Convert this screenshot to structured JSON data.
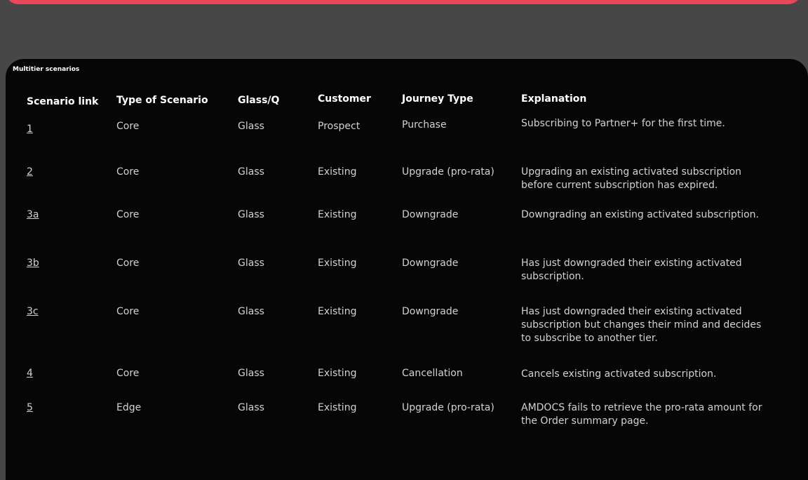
{
  "panel": {
    "title": "Multitier scenarios"
  },
  "headers": [
    "Scenario link",
    "Type of Scenario",
    "Glass/Q",
    "Customer",
    "Journey Type",
    "Explanation"
  ],
  "rows": [
    {
      "link": "1",
      "type": "Core",
      "glass": "Glass",
      "customer": "Prospect",
      "journey": "Purchase",
      "explanation": "Subscribing to Partner+ for the first time."
    },
    {
      "link": "2",
      "type": "Core",
      "glass": "Glass",
      "customer": "Existing",
      "journey": "Upgrade (pro-rata)",
      "explanation": "Upgrading an existing activated subscription before current subscription has expired."
    },
    {
      "link": "3a",
      "type": "Core",
      "glass": "Glass",
      "customer": "Existing",
      "journey": "Downgrade",
      "explanation": "Downgrading an existing activated subscription."
    },
    {
      "link": "3b",
      "type": "Core",
      "glass": "Glass",
      "customer": "Existing",
      "journey": "Downgrade",
      "explanation": "Has just downgraded their existing activated subscription."
    },
    {
      "link": "3c",
      "type": "Core",
      "glass": "Glass",
      "customer": "Existing",
      "journey": "Downgrade",
      "explanation": "Has just downgraded their existing activated subscription but changes their mind and decides to subscribe to another tier."
    },
    {
      "link": "4",
      "type": "Core",
      "glass": "Glass",
      "customer": "Existing",
      "journey": "Cancellation",
      "explanation": "Cancels existing activated subscription."
    },
    {
      "link": "5",
      "type": "Edge",
      "glass": "Glass",
      "customer": "Existing",
      "journey": "Upgrade (pro-rata)",
      "explanation": "AMDOCS fails to retrieve the pro-rata amount for the Order summary page."
    }
  ]
}
